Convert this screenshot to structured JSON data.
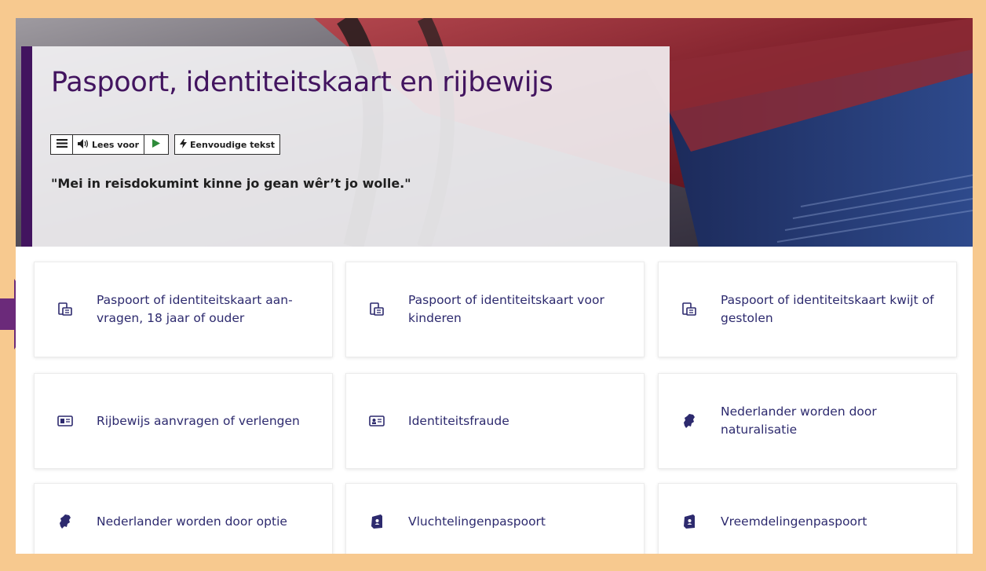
{
  "page": {
    "title": "Paspoort, identiteitskaart en rijbewijs",
    "quote": "\"Mei in reisdokumint kinne jo gean wêr’t jo wolle.\"",
    "accent_color": "#42145f",
    "frame_color": "#f7c98f"
  },
  "toolbar": {
    "menu_icon": "hamburger-icon",
    "read_aloud_label": "Lees voor",
    "read_aloud_icon": "speaker-icon",
    "play_icon": "play-icon",
    "simple_text_label": "Eenvoudige tekst",
    "simple_text_icon": "lightning-icon"
  },
  "tiles": [
    {
      "label": "Paspoort of identiteitskaart aan-vragen, 18 jaar of ouder",
      "icon": "passport-id-icon"
    },
    {
      "label": "Paspoort of identiteitskaart voor kinderen",
      "icon": "passport-id-icon"
    },
    {
      "label": "Paspoort of identiteitskaart kwijt of gestolen",
      "icon": "passport-id-icon"
    },
    {
      "label": "Rijbewijs aanvragen of verlengen",
      "icon": "driving-license-icon"
    },
    {
      "label": "Identiteitsfraude",
      "icon": "id-card-icon"
    },
    {
      "label": "Nederlander worden door naturalisatie",
      "icon": "netherlands-map-icon"
    },
    {
      "label": "Nederlander worden door optie",
      "icon": "netherlands-map-icon"
    },
    {
      "label": "Vluchtelingenpaspoort",
      "icon": "passport-book-icon"
    },
    {
      "label": "Vreemdelingenpaspoort",
      "icon": "passport-book-icon"
    }
  ]
}
